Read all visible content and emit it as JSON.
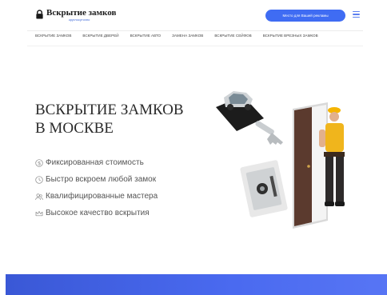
{
  "header": {
    "logo_title": "Вскрытие замков",
    "logo_tagline": "круглосуточно",
    "cta_label": "Место для Вашей рекламы"
  },
  "nav": {
    "items": [
      {
        "label": "Вскрытие замков"
      },
      {
        "label": "Вскрытие дверей"
      },
      {
        "label": "Вскрытие авто"
      },
      {
        "label": "Замена замков"
      },
      {
        "label": "Вскрытие сейфов"
      },
      {
        "label": "Вскрытие врезных замков"
      }
    ]
  },
  "hero": {
    "title_line1": "ВСКРЫТИЕ ЗАМКОВ",
    "title_line2": "В МОСКВЕ",
    "features": [
      {
        "icon": "dollar-icon",
        "label": "Фиксированная стоимость"
      },
      {
        "icon": "clock-icon",
        "label": "Быстро вскроем любой замок"
      },
      {
        "icon": "users-icon",
        "label": "Квалифицированные мастера"
      },
      {
        "icon": "crown-icon",
        "label": "Высокое качество вскрытия"
      }
    ]
  },
  "colors": {
    "accent": "#3f6cf3",
    "band": "#4a6af0",
    "door": "#5b3a2e",
    "worker_shirt": "#f0b51c"
  }
}
